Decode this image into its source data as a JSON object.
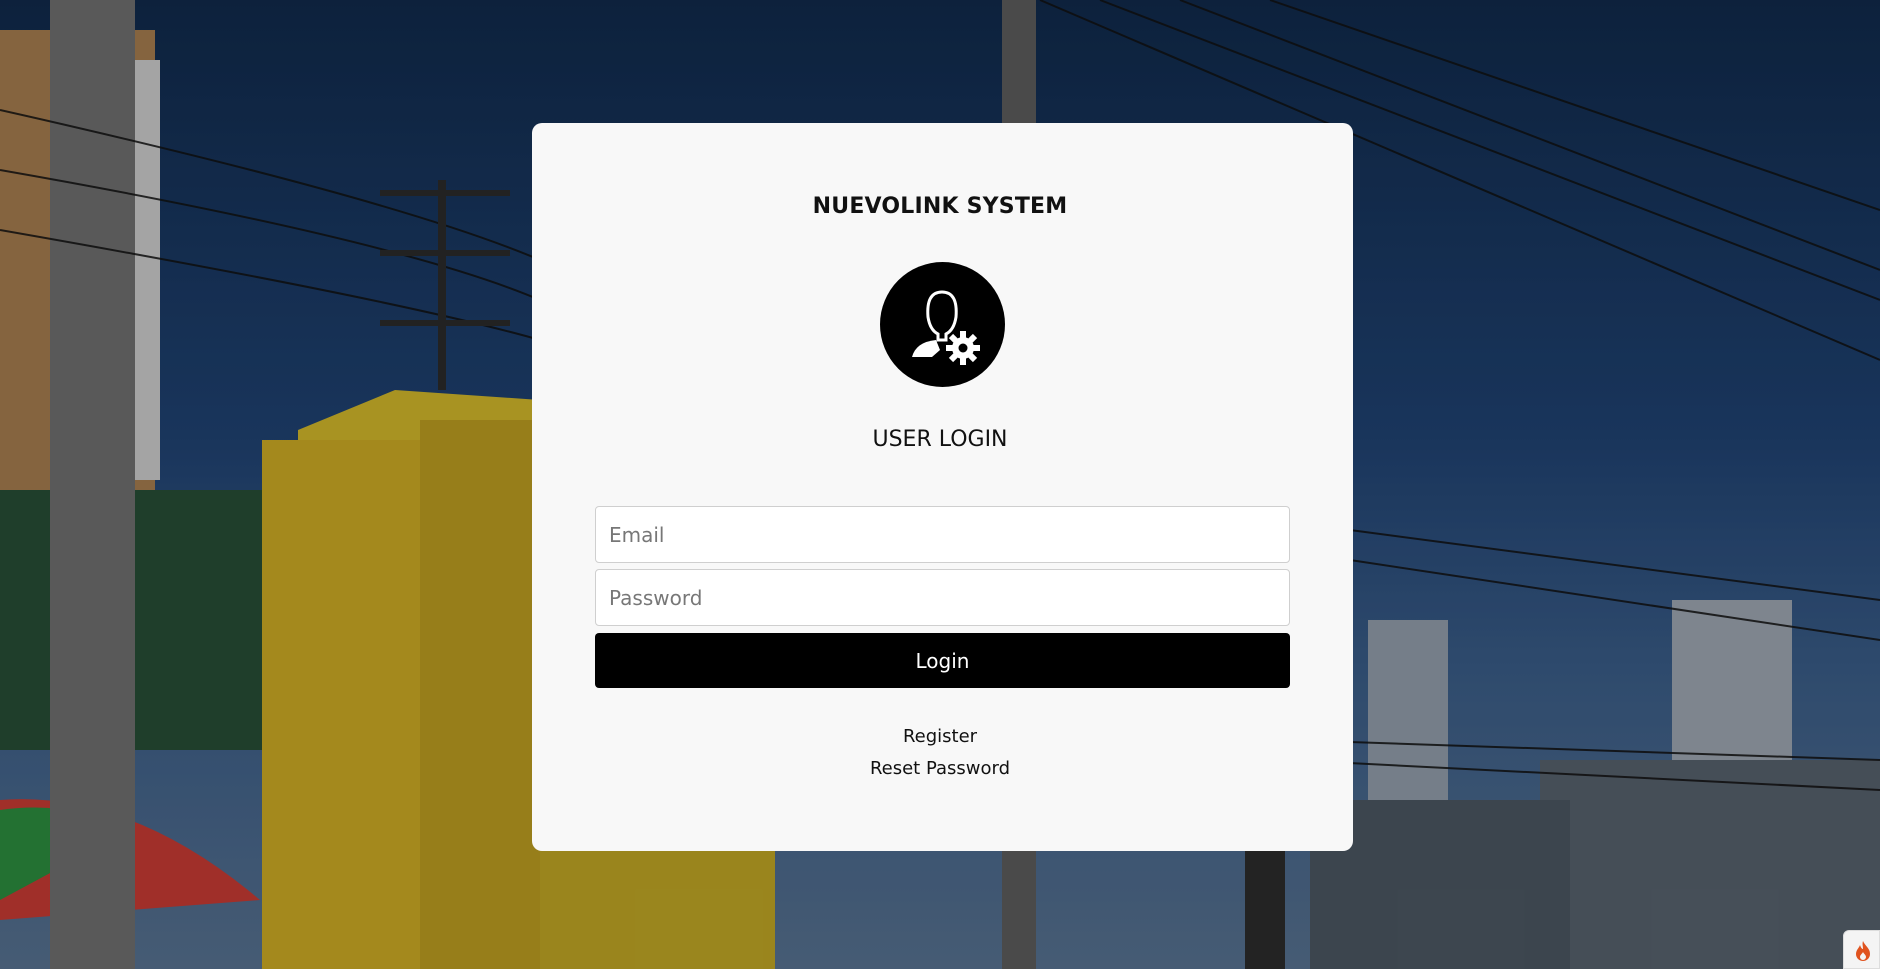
{
  "app": {
    "system_name": "NUEVOLINK SYSTEM",
    "heading": "USER LOGIN"
  },
  "form": {
    "email_placeholder": "Email",
    "email_value": "",
    "password_placeholder": "Password",
    "password_value": "",
    "login_label": "Login"
  },
  "links": {
    "register": "Register",
    "reset_password": "Reset Password"
  },
  "icons": {
    "avatar": "user-settings-icon",
    "corner": "flame-icon"
  },
  "colors": {
    "card_bg": "#f8f8f8",
    "button_bg": "#000000",
    "button_text": "#ffffff",
    "corner_icon": "#e0531f"
  }
}
